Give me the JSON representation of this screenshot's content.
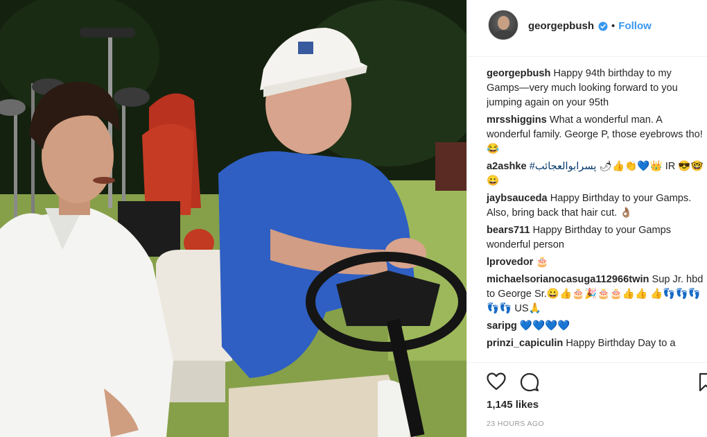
{
  "post": {
    "username": "georgepbush",
    "follow_label": "Follow",
    "separator": "•",
    "likes": "1,145 likes",
    "timestamp": "23 HOURS AGO"
  },
  "comments": [
    {
      "user": "georgepbush",
      "text": "Happy 94th birthday to my Gamps—very much looking forward to you jumping again on your 95th"
    },
    {
      "user": "mrsshiggins",
      "text": "What a wonderful man. A wonderful family. George P, those eyebrows tho! 😂"
    },
    {
      "user": "a2ashke",
      "tag": "#پسرابوالعجائب",
      "text": "🌶👍👏💙👑 IR 😎🤓😀"
    },
    {
      "user": "jaybsauceda",
      "text": "Happy Birthday to your Gamps. Also, bring back that hair cut. 👌🏽"
    },
    {
      "user": "bears711",
      "text": "Happy Birthday to your Gamps wonderful person"
    },
    {
      "user": "lprovedor",
      "text": "🎂"
    },
    {
      "user": "michaelsorianocasuga112966twin",
      "text": "Sup Jr. hbd to George Sr.😀👍🎂🎉🎂🎂👍👍 👍👣👣👣👣👣 US🙏"
    },
    {
      "user": "saripg",
      "text": "💙💙💙💙"
    },
    {
      "user": "prinzi_capiculin",
      "text": "Happy Birthday Day to a"
    }
  ],
  "icons": {
    "verified": "verified-badge-icon",
    "like": "heart-icon",
    "comment": "comment-bubble-icon",
    "save": "bookmark-icon"
  },
  "colors": {
    "link_blue": "#3897f0",
    "text": "#262626",
    "muted": "#999999",
    "divider": "#efefef"
  }
}
